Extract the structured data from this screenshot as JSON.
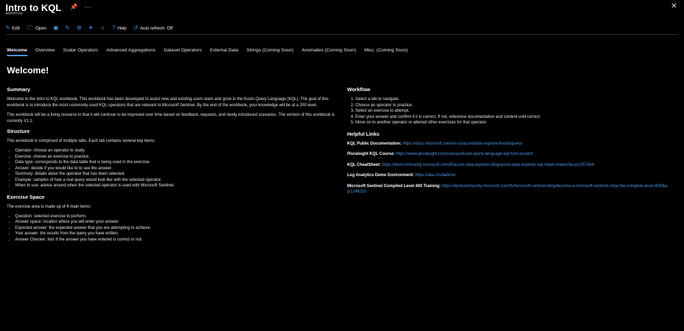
{
  "window": {
    "title": "Intro to KQL",
    "subtitle": "adminsoc",
    "pin_icon": "pin-icon",
    "more_icon": "ellipsis-icon",
    "close_label": "✕"
  },
  "toolbar": {
    "edit": "Edit",
    "open": "Open",
    "help": "Help",
    "auto_refresh": "Auto refresh: Off"
  },
  "tabs": [
    {
      "label": "Welcome",
      "active": true
    },
    {
      "label": "Overview"
    },
    {
      "label": "Scalar Operators"
    },
    {
      "label": "Advanced Aggregations"
    },
    {
      "label": "Dataset Operators"
    },
    {
      "label": "External Data"
    },
    {
      "label": "Strings (Coming Soon)"
    },
    {
      "label": "Anomalies (Coming Soon)"
    },
    {
      "label": "Misc. (Coming Soon)"
    }
  ],
  "main": {
    "heading": "Welcome!",
    "summary": {
      "title": "Summary",
      "p1": "Welcome to the Intro to KQL workbook. This workbook has been developed to assist new and existing users learn and grow in the Kusto Query Language (KQL). The goal of this workbook is to introduce the most commonly used KQL operators that are relevant to Microsoft Sentinel. By the end of the workbook, your knowledge will be at a 200 level.",
      "p2": "This workbook will be a living resource in that it will continue to be improved over time based on feedback, requests, and newly introduced scenarios. The version of this workbook is currently V1.1."
    },
    "structure": {
      "title": "Structure",
      "intro": "This workbook is comprised of multiple tabs. Each tab contains several key items:",
      "items": [
        "Operator: choose an operator to study.",
        "Exercise: choose an exercise to practice.",
        "Data type: corresponds to the data table that is being used in the exercise.",
        "Answer: decide if you would like to to see the answer.",
        "Summary: details about the operator that has been selected.",
        "Example: samples of how a real query would look like with the selected operator.",
        "When to use: advice around when the selected operator is used with Microsoft Sentinel."
      ]
    },
    "exercise_space": {
      "title": "Exercise Space",
      "intro": "The exercise area is made up of 6 main items:",
      "items": [
        "Question: selected exercise to perform.",
        "Answer space: location where you will enter your answer.",
        "Expected answer: the expected answer that you are attempting to achieve.",
        "Your answer: the results from the query you have written.",
        "Answer Checker: lists if the answer you have entered is correct or not."
      ]
    },
    "workflow": {
      "title": "Workflow",
      "items": [
        "Select a tab to navigate.",
        "Choose an operator to practice.",
        "Select an exercise to attempt.",
        "Enter your answer and confirm if it is correct. If not, reference documentation and content until correct.",
        "Move on to another operator or attempt other exercises for that operator."
      ]
    },
    "helpful_links": {
      "title": "Helpful Links",
      "links": [
        {
          "label": "KQL Public Documentation:",
          "url": "https://docs.microsoft.com/en-us/azure/data-explorer/kusto/query/"
        },
        {
          "label": "Pluralsight KQL Course:",
          "url": "https://www.pluralsight.com/courses/kusto-query-language-kql-from-scratch"
        },
        {
          "label": "KQL CheatSheet:",
          "url": "https://techcommunity.microsoft.com/t5/azure-data-explorer-blog/azure-data-explorer-kql-cheat-sheets/ba-p/1057404"
        },
        {
          "label": "Log Analytics Demo Environment:",
          "url": "https://aka.ms/lademo"
        },
        {
          "label": "Microsoft Sentinel Compiled Level 400 Training:",
          "url": "https://techcommunity.microsoft.com/t5/microsoft-sentinel-blog/become-a-microsoft-sentinel-ninja-the-complete-level-400/ba-p/1246310"
        }
      ]
    }
  },
  "colors": {
    "background": "#000000",
    "accent": "#4a9be8",
    "text": "#e8e8e8"
  }
}
